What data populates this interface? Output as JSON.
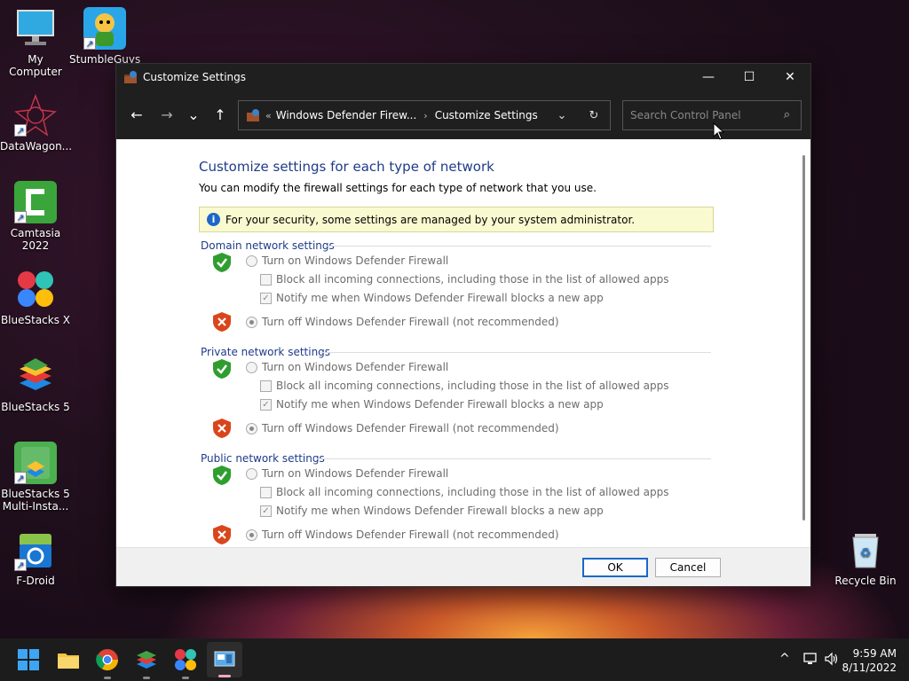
{
  "desktop": {
    "icons": [
      {
        "label": "My Computer"
      },
      {
        "label": "StumbleGuys"
      },
      {
        "label": "DataWagon..."
      },
      {
        "label": "Camtasia 2022"
      },
      {
        "label": "BlueStacks X"
      },
      {
        "label": "BlueStacks 5"
      },
      {
        "label": "BlueStacks 5 Multi-Insta..."
      },
      {
        "label": "F-Droid"
      },
      {
        "label": "Recycle Bin"
      }
    ]
  },
  "window": {
    "title": "Customize Settings",
    "controls": {
      "minimize": "—",
      "maximize": "☐",
      "close": "✕"
    }
  },
  "nav": {
    "back": "←",
    "forward": "→",
    "recent": "⌄",
    "up": "↑",
    "breadcrumb_prefix": "«",
    "breadcrumb": [
      "Windows Defender Firew...",
      "Customize Settings"
    ],
    "breadcrumb_sep": "›",
    "dropdown": "⌄",
    "refresh": "↻",
    "search_placeholder": "Search Control Panel",
    "search_icon": "⌕"
  },
  "main": {
    "heading": "Customize settings for each type of network",
    "subtitle": "You can modify the firewall settings for each type of network that you use.",
    "info": "For your security, some settings are managed by your system administrator.",
    "sections": [
      {
        "title": "Domain network settings",
        "turn_on": "Turn on Windows Defender Firewall",
        "block_all": "Block all incoming connections, including those in the list of allowed apps",
        "notify": "Notify me when Windows Defender Firewall blocks a new app",
        "turn_off": "Turn off Windows Defender Firewall (not recommended)"
      },
      {
        "title": "Private network settings",
        "turn_on": "Turn on Windows Defender Firewall",
        "block_all": "Block all incoming connections, including those in the list of allowed apps",
        "notify": "Notify me when Windows Defender Firewall blocks a new app",
        "turn_off": "Turn off Windows Defender Firewall (not recommended)"
      },
      {
        "title": "Public network settings",
        "turn_on": "Turn on Windows Defender Firewall",
        "block_all": "Block all incoming connections, including those in the list of allowed apps",
        "notify": "Notify me when Windows Defender Firewall blocks a new app",
        "turn_off": "Turn off Windows Defender Firewall (not recommended)"
      }
    ],
    "ok_label": "OK",
    "cancel_label": "Cancel"
  },
  "taskbar": {
    "tray_chevron": "^",
    "time": "9:59 AM",
    "date": "8/11/2022"
  },
  "colors": {
    "heading": "#1e3b8a",
    "info_bg": "#fafad0",
    "shield_green": "#2f9e2f",
    "shield_red": "#d9461c",
    "button_focus": "#1a68c9"
  }
}
